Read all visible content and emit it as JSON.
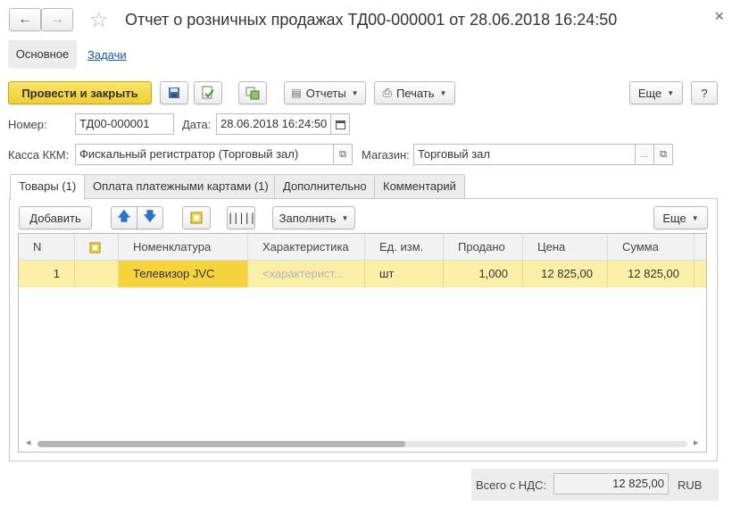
{
  "window": {
    "title": "Отчет о розничных продажах ТД00-000001 от 28.06.2018 16:24:50",
    "back_icon": "arrow-left-icon",
    "forward_icon": "arrow-right-icon",
    "favorite_icon": "star-icon",
    "close_icon": "close-icon"
  },
  "nav": {
    "main": "Основное",
    "tasks": "Задачи"
  },
  "toolbar": {
    "post_close": "Провести и закрыть",
    "reports": "Отчеты",
    "print": "Печать",
    "more": "Еще",
    "help": "?"
  },
  "fields": {
    "number_label": "Номер:",
    "number_value": "ТД00-000001",
    "date_label": "Дата:",
    "date_value": "28.06.2018 16:24:50",
    "register_label": "Касса ККМ:",
    "register_value": "Фискальный регистратор (Торговый зал)",
    "store_label": "Магазин:",
    "store_value": "Торговый зал",
    "ellipsis": "..."
  },
  "tabs": [
    {
      "label": "Товары (1)",
      "active": true
    },
    {
      "label": "Оплата платежными картами (1)",
      "active": false
    },
    {
      "label": "Дополнительно",
      "active": false
    },
    {
      "label": "Комментарий",
      "active": false
    }
  ],
  "table_toolbar": {
    "add": "Добавить",
    "fill": "Заполнить",
    "more": "Еще"
  },
  "table": {
    "columns": [
      "N",
      "",
      "Номенклатура",
      "Характеристика",
      "Ед. изм.",
      "Продано",
      "Цена",
      "Сумма"
    ],
    "rows": [
      {
        "n": "1",
        "item": "Телевизор JVC",
        "characteristic": "<характерист...",
        "unit": "шт",
        "sold": "1,000",
        "price": "12 825,00",
        "sum": "12 825,00"
      }
    ]
  },
  "footer": {
    "total_label": "Всего с НДС:",
    "total_value": "12 825,00",
    "currency": "RUB"
  },
  "colors": {
    "accent_yellow": "#f5d84a",
    "selected_row": "#fbeea6",
    "selected_cell": "#f4d33c"
  }
}
